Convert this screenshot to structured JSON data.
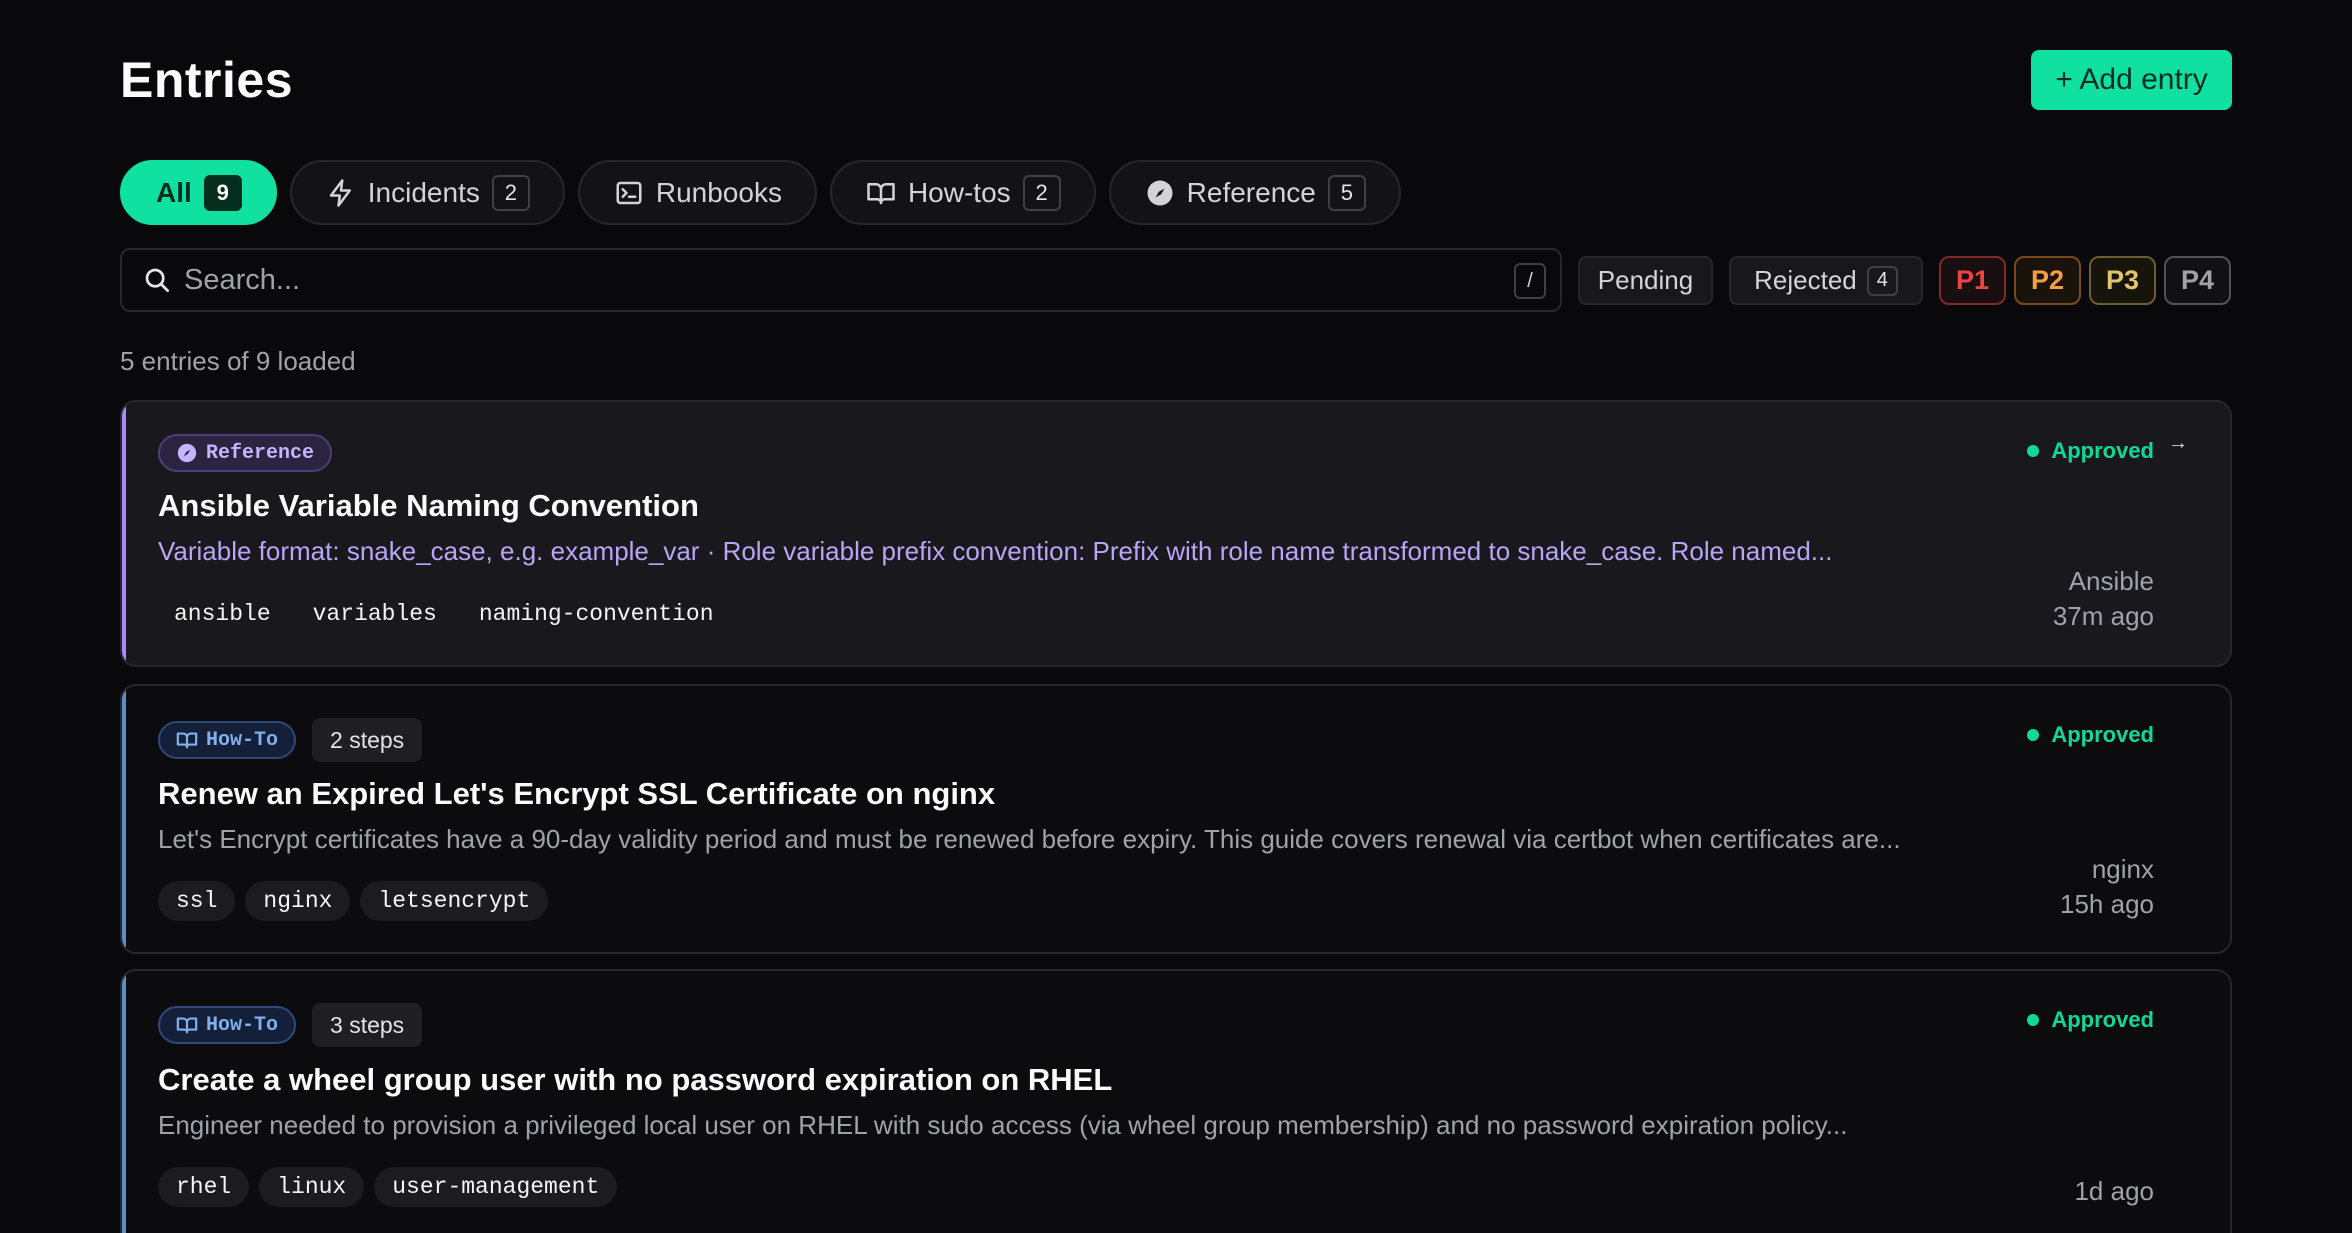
{
  "header": {
    "title": "Entries",
    "add_label": "+ Add entry"
  },
  "tabs": [
    {
      "label": "All",
      "count": "9",
      "icon": ""
    },
    {
      "label": "Incidents",
      "count": "2",
      "icon": "bolt-icon"
    },
    {
      "label": "Runbooks",
      "count": "",
      "icon": "terminal-icon"
    },
    {
      "label": "How-tos",
      "count": "2",
      "icon": "book-icon"
    },
    {
      "label": "Reference",
      "count": "5",
      "icon": "compass-icon"
    }
  ],
  "search": {
    "placeholder": "Search...",
    "shortcut": "/"
  },
  "filters": {
    "pending_label": "Pending",
    "rejected_label": "Rejected",
    "rejected_count": "4",
    "priorities": [
      {
        "label": "P1",
        "color": "#ef4444"
      },
      {
        "label": "P2",
        "color": "#f59e42"
      },
      {
        "label": "P3",
        "color": "#e2c46e"
      },
      {
        "label": "P4",
        "color": "#a1a1aa"
      }
    ]
  },
  "summary": "5 entries of 9 loaded",
  "entries": [
    {
      "type": "Reference",
      "title": "Ansible Variable Naming Convention",
      "description": "Variable format: snake_case, e.g. example_var · Role variable prefix convention: Prefix with role name transformed to snake_case. Role named...",
      "tags": [
        "ansible",
        "variables",
        "naming-convention"
      ],
      "status": "Approved",
      "category": "Ansible",
      "time": "37m ago",
      "arrow": "→"
    },
    {
      "type": "How-To",
      "steps": "2 steps",
      "title": "Renew an Expired Let's Encrypt SSL Certificate on nginx",
      "description": "Let's Encrypt certificates have a 90-day validity period and must be renewed before expiry. This guide covers renewal via certbot when certificates are...",
      "tags": [
        "ssl",
        "nginx",
        "letsencrypt"
      ],
      "status": "Approved",
      "category": "nginx",
      "time": "15h ago"
    },
    {
      "type": "How-To",
      "steps": "3 steps",
      "title": "Create a wheel group user with no password expiration on RHEL",
      "description": "Engineer needed to provision a privileged local user on RHEL with sudo access (via wheel group membership) and no password expiration policy...",
      "tags": [
        "rhel",
        "linux",
        "user-management"
      ],
      "status": "Approved",
      "category": "",
      "time": "1d ago"
    }
  ],
  "colors": {
    "accent": "#10e0a0",
    "reference": "#a78bfa",
    "howto": "#5b8fc9",
    "approved": "#10d996"
  }
}
